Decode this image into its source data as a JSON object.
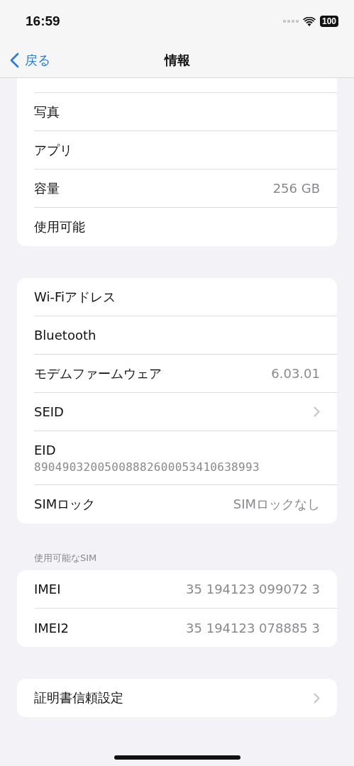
{
  "status_bar": {
    "time": "16:59",
    "battery": "100"
  },
  "nav": {
    "back": "戻る",
    "title": "情報"
  },
  "groups": [
    {
      "cut_top": true,
      "rows": [
        {
          "kind": "value",
          "label": "写真"
        },
        {
          "kind": "value",
          "label": "アプリ"
        },
        {
          "kind": "value",
          "label": "容量",
          "value": "256 GB"
        },
        {
          "kind": "value",
          "label": "使用可能"
        }
      ]
    },
    {
      "rows": [
        {
          "kind": "value",
          "label": "Wi-Fiアドレス"
        },
        {
          "kind": "value",
          "label": "Bluetooth"
        },
        {
          "kind": "value",
          "label": "モデムファームウェア",
          "value": "6.03.01"
        },
        {
          "kind": "chevron",
          "label": "SEID"
        },
        {
          "kind": "stacked",
          "label": "EID",
          "value": "89049032005008882600053410638993"
        },
        {
          "kind": "value",
          "label": "SIMロック",
          "value": "SIMロックなし"
        }
      ]
    },
    {
      "header": "使用可能なSIM",
      "rows": [
        {
          "kind": "value",
          "label": "IMEI",
          "value": "35 194123 099072 3"
        },
        {
          "kind": "value",
          "label": "IMEI2",
          "value": "35 194123 078885 3"
        }
      ]
    },
    {
      "rows": [
        {
          "kind": "chevron",
          "label": "証明書信頼設定"
        }
      ]
    }
  ]
}
